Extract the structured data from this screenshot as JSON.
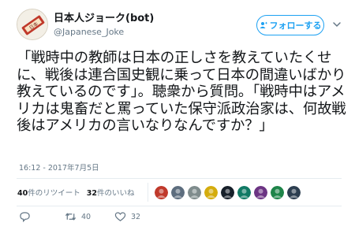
{
  "user": {
    "display_name": "日本人ジョーク(bot)",
    "handle": "@Japanese_Joke",
    "avatar_text": "日本"
  },
  "follow_button": {
    "label": "フォローする"
  },
  "tweet": {
    "text": "「戦時中の教師は日本の正しさを教えていたくせに、戦後は連合国史観に乗って日本の間違いばかり教えているのです」。聴衆から質問。「戦時中はアメリカは鬼畜だと罵っていた保守派政治家は、何故戦後はアメリカの言いなりなんですか？」",
    "timestamp": "16:12 - 2017年7月5日"
  },
  "stats": {
    "retweets_count": "40",
    "retweets_label": "件のリツイート",
    "likes_count": "32",
    "likes_label": "件のいいね"
  },
  "liker_avatars": [
    "#c0392b",
    "#5d6d7e",
    "#7f8c8d",
    "#d4ac0d",
    "#17202a",
    "#117a65",
    "#6c3483",
    "#1e8449",
    "#2c3e50"
  ],
  "actions": {
    "reply_count": "",
    "retweet_count": "40",
    "like_count": "32"
  },
  "colors": {
    "accent": "#1da1f2",
    "text": "#14171a",
    "muted": "#657786"
  }
}
